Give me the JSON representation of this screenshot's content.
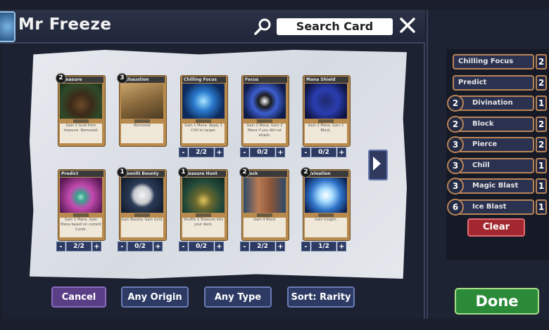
{
  "header": {
    "title": "Mr Freeze",
    "search_label": "Search Card"
  },
  "cards": [
    {
      "name": "Treasure",
      "cost": "2",
      "text": "Gain 2 Gold from treasure. Removed.",
      "qty": "",
      "art": "treasure"
    },
    {
      "name": "Exhaustion",
      "cost": "3",
      "text": "Removed",
      "qty": "",
      "art": "exhaustion"
    },
    {
      "name": "Chilling Focus",
      "cost": "",
      "text": "Gain 1 Mana. Apply 1 Chill to target.",
      "qty": "2/2",
      "art": "chilling"
    },
    {
      "name": "Focus",
      "cost": "",
      "text": "Gain 2 Mana. Gain 2 Mana if you did not attack.",
      "qty": "0/2",
      "art": "focus"
    },
    {
      "name": "Mana Shield",
      "cost": "",
      "text": "Gain 2 Mana. Gain 1 Block.",
      "qty": "0/2",
      "art": "shield"
    },
    {
      "name": "Predict",
      "cost": "",
      "text": "Gain 1 Mana. Gain Mana based on current Cards.",
      "qty": "2/2",
      "art": "predict"
    },
    {
      "name": "Moonlit Bounty",
      "cost": "1",
      "text": "Gain Bounty. Gain Gold.",
      "qty": "0/2",
      "art": "moon"
    },
    {
      "name": "Treasure Hunt",
      "cost": "1",
      "text": "Shuffle 1 Treasure into your deck.",
      "qty": "0/2",
      "art": "hunt"
    },
    {
      "name": "Block",
      "cost": "2",
      "text": "Gain 4 Block",
      "qty": "2/2",
      "art": "block"
    },
    {
      "name": "Divination",
      "cost": "2",
      "text": "Gain Insight.",
      "qty": "1/2",
      "art": "divination"
    }
  ],
  "deck": [
    {
      "name": "Chilling Focus",
      "cost": "",
      "count": "2"
    },
    {
      "name": "Predict",
      "cost": "",
      "count": "2"
    },
    {
      "name": "Divination",
      "cost": "2",
      "count": "1"
    },
    {
      "name": "Block",
      "cost": "2",
      "count": "2"
    },
    {
      "name": "Pierce",
      "cost": "3",
      "count": "2"
    },
    {
      "name": "Chill",
      "cost": "3",
      "count": "1"
    },
    {
      "name": "Magic Blast",
      "cost": "3",
      "count": "1"
    },
    {
      "name": "Ice Blast",
      "cost": "6",
      "count": "1"
    }
  ],
  "buttons": {
    "cancel": "Cancel",
    "origin": "Any Origin",
    "type": "Any Type",
    "sort": "Sort: Rarity",
    "clear": "Clear",
    "done": "Done"
  },
  "icons": {
    "search": "search-icon",
    "close": "close-icon",
    "next": "chevron-right-icon",
    "logo": "hero-portrait-icon"
  },
  "colors": {
    "clear": "#a3272f",
    "done": "#2b8a38",
    "card_frame": "#b88a4e"
  }
}
